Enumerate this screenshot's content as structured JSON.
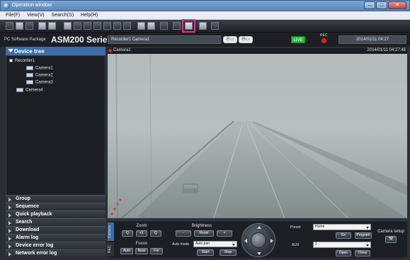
{
  "window": {
    "title": "Operation window"
  },
  "menu": [
    "File(F)",
    "View(V)",
    "Search(S)",
    "Help(H)"
  ],
  "header": {
    "brand_small": "PC Software Package",
    "brand_big": "ASM200 Series",
    "camera_label": "Recorder1 Camera1",
    "live_label": "LIVE",
    "rec_label": "REC",
    "datetime": "2014/01/11 04:27"
  },
  "sidebar": {
    "device_tree_title": "Device tree",
    "tree": {
      "recorder": "Recorder1",
      "cameras": [
        "Camera1",
        "Camera2",
        "Camera3"
      ],
      "standalone": "Camera4"
    },
    "sections": [
      "Group",
      "Sequence",
      "Quick playback",
      "Search",
      "Download",
      "Alarm log",
      "Device error log",
      "Network error log"
    ]
  },
  "camera_view": {
    "name": "Camera1",
    "timestamp": "2014/01/11 04:27:48"
  },
  "controls": {
    "side_tab_camera": "Camera",
    "side_tab_rec": "REC",
    "zoom": {
      "title": "Zoom",
      "minus": "Q",
      "x1": "x1",
      "plus": "Q"
    },
    "focus": {
      "title": "Focus",
      "auto": "Auto",
      "near": "Near",
      "far": "Far"
    },
    "brightness": {
      "title": "Brightness",
      "minus": "-",
      "reset": "Reset",
      "plus": "+"
    },
    "auto_mode": {
      "label": "Auto mode",
      "value": "Auto pan",
      "start": "Start",
      "stop": "Stop"
    },
    "preset": {
      "label": "Preset",
      "value": "Home",
      "go": "Go",
      "program": "Program"
    },
    "aux": {
      "label": "AUX",
      "value": "1",
      "open": "Open",
      "close": "Close"
    },
    "camera_setup": "Camera setup"
  },
  "colors": {
    "accent_blue": "#3c6ea8",
    "live_green": "#1fbf3a",
    "rec_red": "#e32020",
    "highlight_pink": "#e0308a"
  }
}
